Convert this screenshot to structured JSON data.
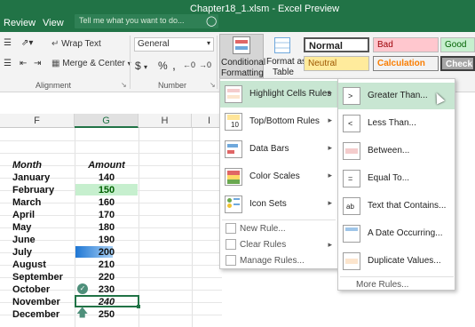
{
  "titlebar": {
    "title": "Chapter18_1.xlsm - Excel Preview",
    "tabs": [
      "Review",
      "View"
    ],
    "tell_me_placeholder": "Tell me what you want to do...",
    "bg": "#217346"
  },
  "ribbon": {
    "alignment": {
      "wrap_text": "Wrap Text",
      "merge_center": "Merge & Center",
      "group_label": "Alignment"
    },
    "number": {
      "format": "General",
      "currency": "$",
      "percent": "%",
      "comma": ",",
      "group_label": "Number"
    },
    "conditional_formatting": {
      "line1": "Conditional",
      "line2": "Formatting"
    },
    "format_as_table": {
      "line1": "Format as",
      "line2": "Table"
    },
    "styles": [
      {
        "label": "Normal"
      },
      {
        "label": "Bad"
      },
      {
        "label": "Good"
      },
      {
        "label": "Neutral"
      },
      {
        "label": "Calculation"
      },
      {
        "label": "Check C"
      }
    ]
  },
  "sheet": {
    "columns": [
      "F",
      "G",
      "H",
      "I"
    ],
    "header_row": {
      "month": "Month",
      "amount": "Amount"
    },
    "rows": [
      {
        "month": "January",
        "amount": "140"
      },
      {
        "month": "February",
        "amount": "150"
      },
      {
        "month": "March",
        "amount": "160"
      },
      {
        "month": "April",
        "amount": "170"
      },
      {
        "month": "May",
        "amount": "180"
      },
      {
        "month": "June",
        "amount": "190"
      },
      {
        "month": "July",
        "amount": "200"
      },
      {
        "month": "August",
        "amount": "210"
      },
      {
        "month": "September",
        "amount": "220"
      },
      {
        "month": "October",
        "amount": "230"
      },
      {
        "month": "November",
        "amount": "240"
      },
      {
        "month": "December",
        "amount": "250"
      }
    ]
  },
  "cf_menu": {
    "items": [
      {
        "label": "Highlight Cells Rules",
        "icon": "highlight-cells-icon"
      },
      {
        "label": "Top/Bottom Rules",
        "icon": "top-bottom-icon"
      },
      {
        "label": "Data Bars",
        "icon": "data-bars-icon"
      },
      {
        "label": "Color Scales",
        "icon": "color-scales-icon"
      },
      {
        "label": "Icon Sets",
        "icon": "icon-sets-icon"
      }
    ],
    "small_items": [
      {
        "label": "New Rule..."
      },
      {
        "label": "Clear Rules"
      },
      {
        "label": "Manage Rules..."
      }
    ]
  },
  "submenu": {
    "items": [
      {
        "label": "Greater Than...",
        "icon": "greater-than-icon"
      },
      {
        "label": "Less Than...",
        "icon": "less-than-icon"
      },
      {
        "label": "Between...",
        "icon": "between-icon"
      },
      {
        "label": "Equal To...",
        "icon": "equal-to-icon"
      },
      {
        "label": "Text that Contains...",
        "icon": "text-contains-icon"
      },
      {
        "label": "A Date Occurring...",
        "icon": "date-occurring-icon"
      },
      {
        "label": "Duplicate Values...",
        "icon": "duplicate-values-icon"
      }
    ],
    "more_rules": "More Rules..."
  }
}
